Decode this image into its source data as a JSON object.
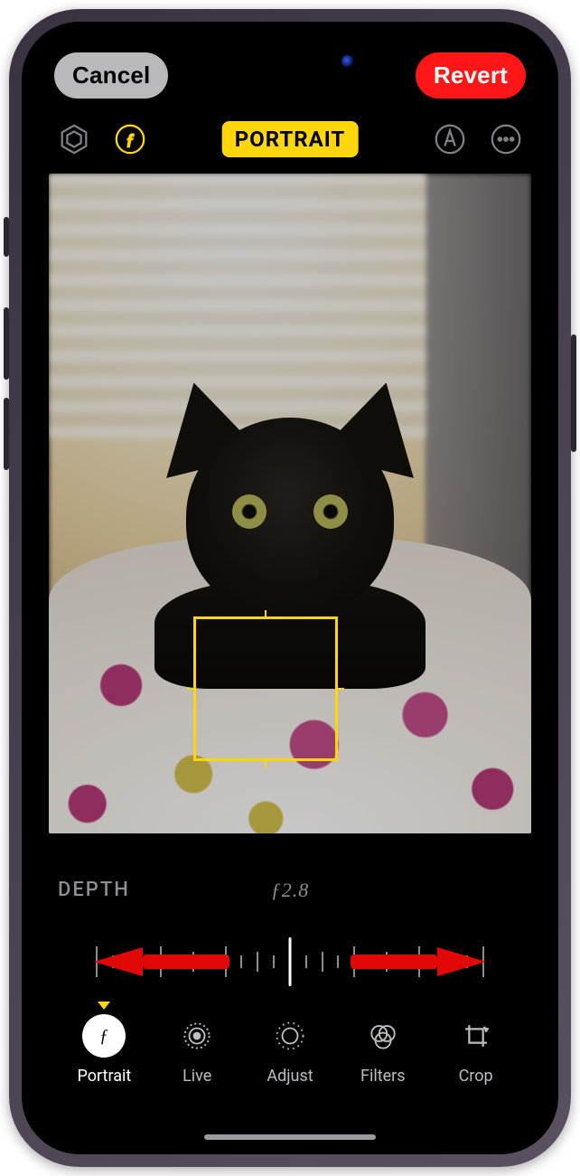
{
  "top": {
    "cancel_label": "Cancel",
    "revert_label": "Revert"
  },
  "mode_badge": "PORTRAIT",
  "depth": {
    "label": "DEPTH",
    "value": "ƒ2.8"
  },
  "tabs": {
    "portrait": "Portrait",
    "live": "Live",
    "adjust": "Adjust",
    "filters": "Filters",
    "crop": "Crop"
  },
  "active_tab": "portrait",
  "toolbar": {
    "left1": "lighting-effect-icon",
    "left2": "aperture-icon",
    "right1": "markup-icon",
    "right2": "more-icon"
  }
}
